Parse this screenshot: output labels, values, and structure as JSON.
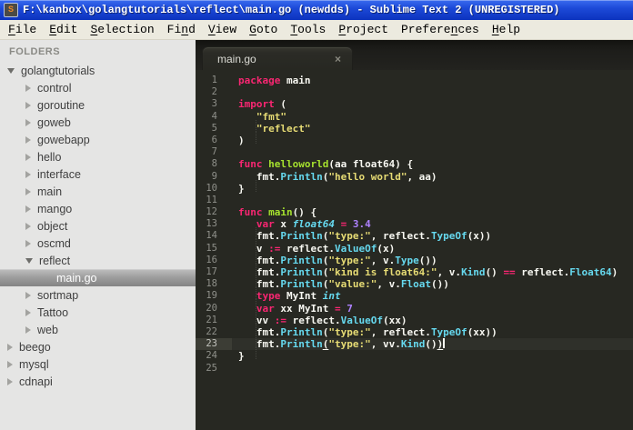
{
  "window": {
    "title": "F:\\kanbox\\golangtutorials\\reflect\\main.go (newdds) - Sublime Text 2 (UNREGISTERED)",
    "icon_letter": "S"
  },
  "menu": {
    "items": [
      {
        "id": "file",
        "pre": "",
        "key": "F",
        "post": "ile"
      },
      {
        "id": "edit",
        "pre": "",
        "key": "E",
        "post": "dit"
      },
      {
        "id": "selection",
        "pre": "",
        "key": "S",
        "post": "election"
      },
      {
        "id": "find",
        "pre": "Fi",
        "key": "n",
        "post": "d"
      },
      {
        "id": "view",
        "pre": "",
        "key": "V",
        "post": "iew"
      },
      {
        "id": "goto",
        "pre": "",
        "key": "G",
        "post": "oto"
      },
      {
        "id": "tools",
        "pre": "",
        "key": "T",
        "post": "ools"
      },
      {
        "id": "project",
        "pre": "",
        "key": "P",
        "post": "roject"
      },
      {
        "id": "preferences",
        "pre": "Prefere",
        "key": "n",
        "post": "ces"
      },
      {
        "id": "help",
        "pre": "",
        "key": "H",
        "post": "elp"
      }
    ]
  },
  "sidebar": {
    "header": "FOLDERS",
    "tree": [
      {
        "label": "golangtutorials",
        "depth": 0,
        "state": "expanded",
        "selected": false
      },
      {
        "label": "control",
        "depth": 1,
        "state": "collapsed",
        "selected": false
      },
      {
        "label": "goroutine",
        "depth": 1,
        "state": "collapsed",
        "selected": false
      },
      {
        "label": "goweb",
        "depth": 1,
        "state": "collapsed",
        "selected": false
      },
      {
        "label": "gowebapp",
        "depth": 1,
        "state": "collapsed",
        "selected": false
      },
      {
        "label": "hello",
        "depth": 1,
        "state": "collapsed",
        "selected": false
      },
      {
        "label": "interface",
        "depth": 1,
        "state": "collapsed",
        "selected": false
      },
      {
        "label": "main",
        "depth": 1,
        "state": "collapsed",
        "selected": false
      },
      {
        "label": "mango",
        "depth": 1,
        "state": "collapsed",
        "selected": false
      },
      {
        "label": "object",
        "depth": 1,
        "state": "collapsed",
        "selected": false
      },
      {
        "label": "oscmd",
        "depth": 1,
        "state": "collapsed",
        "selected": false
      },
      {
        "label": "reflect",
        "depth": 1,
        "state": "expanded",
        "selected": false
      },
      {
        "label": "main.go",
        "depth": 2,
        "state": "file",
        "selected": true
      },
      {
        "label": "sortmap",
        "depth": 1,
        "state": "collapsed",
        "selected": false
      },
      {
        "label": "Tattoo",
        "depth": 1,
        "state": "collapsed",
        "selected": false
      },
      {
        "label": "web",
        "depth": 1,
        "state": "collapsed",
        "selected": false
      },
      {
        "label": "beego",
        "depth": 0,
        "state": "collapsed",
        "selected": false
      },
      {
        "label": "mysql",
        "depth": 0,
        "state": "collapsed",
        "selected": false
      },
      {
        "label": "cdnapi",
        "depth": 0,
        "state": "collapsed",
        "selected": false
      }
    ]
  },
  "tabs": [
    {
      "label": "main.go",
      "close_glyph": "×",
      "active": true
    }
  ],
  "editor": {
    "current_line": 23,
    "lines": [
      {
        "no": 1,
        "segs": [
          [
            "package",
            "k"
          ],
          [
            " main",
            "p"
          ]
        ]
      },
      {
        "no": 2,
        "segs": []
      },
      {
        "no": 3,
        "segs": [
          [
            "import",
            "k"
          ],
          [
            " (",
            "p"
          ]
        ]
      },
      {
        "no": 4,
        "segs": [
          [
            "",
            "ind"
          ],
          [
            "\"fmt\"",
            "s"
          ]
        ]
      },
      {
        "no": 5,
        "segs": [
          [
            "",
            "ind"
          ],
          [
            "\"reflect\"",
            "s"
          ]
        ]
      },
      {
        "no": 6,
        "segs": [
          [
            ")",
            "p"
          ]
        ]
      },
      {
        "no": 7,
        "segs": []
      },
      {
        "no": 8,
        "segs": [
          [
            "func",
            "k"
          ],
          [
            " ",
            "p"
          ],
          [
            "helloworld",
            "fn"
          ],
          [
            "(aa float64) {",
            "p"
          ]
        ]
      },
      {
        "no": 9,
        "segs": [
          [
            "",
            "ind"
          ],
          [
            "fmt.",
            "p"
          ],
          [
            "Println",
            "c"
          ],
          [
            "(",
            "p"
          ],
          [
            "\"hello world\"",
            "s"
          ],
          [
            ", aa)",
            "p"
          ]
        ]
      },
      {
        "no": 10,
        "segs": [
          [
            "}",
            "p"
          ]
        ]
      },
      {
        "no": 11,
        "segs": []
      },
      {
        "no": 12,
        "segs": [
          [
            "func",
            "k"
          ],
          [
            " ",
            "p"
          ],
          [
            "main",
            "fn"
          ],
          [
            "() {",
            "p"
          ]
        ]
      },
      {
        "no": 13,
        "segs": [
          [
            "",
            "ind"
          ],
          [
            "var",
            "k"
          ],
          [
            " x ",
            "p"
          ],
          [
            "float64",
            "t"
          ],
          [
            " ",
            "p"
          ],
          [
            "=",
            "k"
          ],
          [
            " ",
            "p"
          ],
          [
            "3.4",
            "n"
          ]
        ]
      },
      {
        "no": 14,
        "segs": [
          [
            "",
            "ind"
          ],
          [
            "fmt.",
            "p"
          ],
          [
            "Println",
            "c"
          ],
          [
            "(",
            "p"
          ],
          [
            "\"type:\"",
            "s"
          ],
          [
            ", reflect.",
            "p"
          ],
          [
            "TypeOf",
            "c"
          ],
          [
            "(x))",
            "p"
          ]
        ]
      },
      {
        "no": 15,
        "segs": [
          [
            "",
            "ind"
          ],
          [
            "v ",
            "p"
          ],
          [
            ":=",
            "k"
          ],
          [
            " reflect.",
            "p"
          ],
          [
            "ValueOf",
            "c"
          ],
          [
            "(x)",
            "p"
          ]
        ]
      },
      {
        "no": 16,
        "segs": [
          [
            "",
            "ind"
          ],
          [
            "fmt.",
            "p"
          ],
          [
            "Println",
            "c"
          ],
          [
            "(",
            "p"
          ],
          [
            "\"type:\"",
            "s"
          ],
          [
            ", v.",
            "p"
          ],
          [
            "Type",
            "c"
          ],
          [
            "())",
            "p"
          ]
        ]
      },
      {
        "no": 17,
        "segs": [
          [
            "",
            "ind"
          ],
          [
            "fmt.",
            "p"
          ],
          [
            "Println",
            "c"
          ],
          [
            "(",
            "p"
          ],
          [
            "\"kind is float64:\"",
            "s"
          ],
          [
            ", v.",
            "p"
          ],
          [
            "Kind",
            "c"
          ],
          [
            "() ",
            "p"
          ],
          [
            "==",
            "k"
          ],
          [
            " reflect.",
            "p"
          ],
          [
            "Float64",
            "c"
          ],
          [
            ")",
            "p"
          ]
        ]
      },
      {
        "no": 18,
        "segs": [
          [
            "",
            "ind"
          ],
          [
            "fmt.",
            "p"
          ],
          [
            "Println",
            "c"
          ],
          [
            "(",
            "p"
          ],
          [
            "\"value:\"",
            "s"
          ],
          [
            ", v.",
            "p"
          ],
          [
            "Float",
            "c"
          ],
          [
            "())",
            "p"
          ]
        ]
      },
      {
        "no": 19,
        "segs": [
          [
            "",
            "ind"
          ],
          [
            "type",
            "k"
          ],
          [
            " MyInt ",
            "p"
          ],
          [
            "int",
            "t"
          ]
        ]
      },
      {
        "no": 20,
        "segs": [
          [
            "",
            "ind"
          ],
          [
            "var",
            "k"
          ],
          [
            " xx MyInt ",
            "p"
          ],
          [
            "=",
            "k"
          ],
          [
            " ",
            "p"
          ],
          [
            "7",
            "n"
          ]
        ]
      },
      {
        "no": 21,
        "segs": [
          [
            "",
            "ind"
          ],
          [
            "vv ",
            "p"
          ],
          [
            ":=",
            "k"
          ],
          [
            " reflect.",
            "p"
          ],
          [
            "ValueOf",
            "c"
          ],
          [
            "(xx)",
            "p"
          ]
        ]
      },
      {
        "no": 22,
        "segs": [
          [
            "",
            "ind"
          ],
          [
            "fmt.",
            "p"
          ],
          [
            "Println",
            "c"
          ],
          [
            "(",
            "p"
          ],
          [
            "\"type:\"",
            "s"
          ],
          [
            ", reflect.",
            "p"
          ],
          [
            "TypeOf",
            "c"
          ],
          [
            "(xx))",
            "p"
          ]
        ]
      },
      {
        "no": 23,
        "current": true,
        "caret": true,
        "segs": [
          [
            "",
            "ind"
          ],
          [
            "fmt.",
            "p"
          ],
          [
            "Println",
            "c"
          ],
          [
            "(",
            "u"
          ],
          [
            "\"type:\"",
            "s"
          ],
          [
            ", vv.",
            "p"
          ],
          [
            "Kind",
            "c"
          ],
          [
            "()",
            "p"
          ],
          [
            ")",
            "u"
          ]
        ]
      },
      {
        "no": 24,
        "segs": [
          [
            "}",
            "p"
          ]
        ]
      },
      {
        "no": 25,
        "segs": []
      }
    ]
  },
  "colors": {
    "titlebar_blue": "#1d4ad8",
    "menubar_bg": "#eceadf",
    "sidebar_bg": "#e5e5e4",
    "sidebar_selection": "#9d9d9d",
    "editor_bg": "#272822",
    "keyword_pink": "#f92672",
    "function_green": "#a6e22e",
    "string_yellow": "#e6db74",
    "type_cyan": "#66d9ef",
    "number_purple": "#ae81ff",
    "plain_fg": "#f8f8f2",
    "line_number_gray": "#8f908a"
  }
}
